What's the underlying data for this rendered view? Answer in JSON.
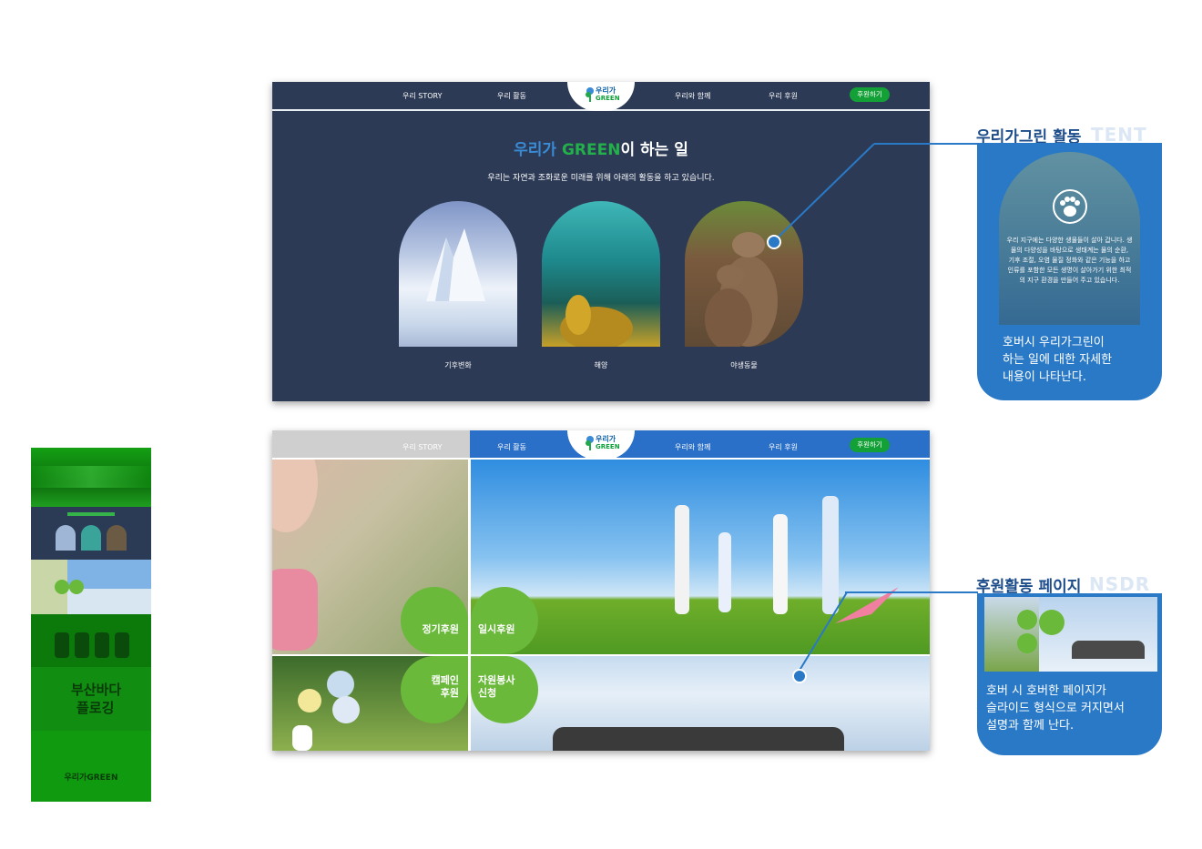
{
  "nav": {
    "items": [
      "우리 STORY",
      "우리 활동",
      "우리와 함께",
      "우리 후원"
    ],
    "cta": "후원하기",
    "logo_line1": "우리가",
    "logo_line2": "GREEN"
  },
  "activity": {
    "title_prefix": "우리가 ",
    "title_green": "GREEN",
    "title_suffix": "이 하는 일",
    "subtitle": "우리는 자연과 조화로운 미래를 위해 아래의 활동을 하고 있습니다.",
    "cards": [
      "기후변화",
      "해양",
      "야생동물"
    ]
  },
  "support": {
    "bubbles": [
      "정기후원",
      "일시후원",
      "캠페인\n후원",
      "자원봉사\n신청"
    ]
  },
  "annotation_activity": {
    "title": "우리가그린 활동",
    "ghost": "TENT",
    "hover_text_1": "우리 지구에는 다양한 생물들이 살아 갑니다. 생",
    "hover_text_2": "물의 다양성을 바탕으로 생태계는 물의 순환,",
    "hover_text_3": "기후 조절, 오염 물질 정화와 같은 기능을 하고",
    "hover_text_4": "인류를 포함한 모든 생명이 살아가기 위한 최적",
    "hover_text_5": "의 지구 환경을 만들어 주고 있습니다.",
    "description": "호버시 우리가그린이\n하는 일에 대한 자세한\n내용이 나타난다."
  },
  "annotation_support": {
    "title": "후원활동 페이지",
    "ghost": "NSDR",
    "description": "호버 시 호버한 페이지가\n슬라이드 형식으로 커지면서\n설명과 함께 난다."
  },
  "thumbnail": {
    "word_1": "부산바다",
    "word_2": "플로깅",
    "footer_word": "우리가GREEN"
  },
  "colors": {
    "navy": "#2c3a55",
    "green": "#13a036",
    "blue": "#2a79c6",
    "bubble": "#6ab93a"
  }
}
